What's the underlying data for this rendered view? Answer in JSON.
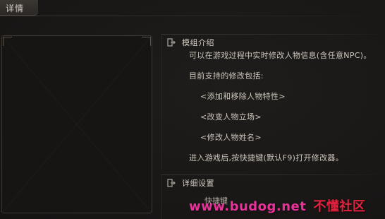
{
  "header": {
    "title": "详情"
  },
  "mod_intro": {
    "title": "模组介绍",
    "icon": "exit-door-icon",
    "lines": [
      "可以在游戏过程中实时修改人物信息(含任意NPC)。",
      "目前支持的修改包括:",
      "<添加和移除人物特性>",
      "<改变人物立场>",
      "<修改人物姓名>",
      "进入游戏后,按快捷键(默认F9)打开修改器。"
    ]
  },
  "details": {
    "title": "详细设置",
    "icon": "exit-door-icon",
    "hotkey_label": "快捷键"
  },
  "watermark": {
    "site": "www.budog.net",
    "brand": "不懂社区"
  },
  "colors": {
    "background": "#1a1817",
    "text": "#cdc6bd",
    "watermark_site": "#e8329a",
    "watermark_brand": "#e0223f"
  }
}
